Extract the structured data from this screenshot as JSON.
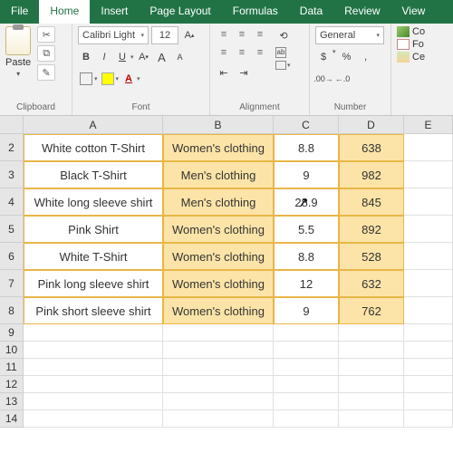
{
  "tabs": [
    "File",
    "Home",
    "Insert",
    "Page Layout",
    "Formulas",
    "Data",
    "Review",
    "View"
  ],
  "active_tab": "Home",
  "ribbon": {
    "clipboard": {
      "title": "Clipboard",
      "paste": "Paste"
    },
    "font": {
      "title": "Font",
      "name": "Calibri Light",
      "size": "12"
    },
    "alignment": {
      "title": "Alignment"
    },
    "number": {
      "title": "Number",
      "format": "General"
    },
    "styles": {
      "cond": "Co",
      "table": "Fo",
      "cell": "Ce"
    }
  },
  "columns": [
    "A",
    "B",
    "C",
    "D",
    "E"
  ],
  "rows": [
    {
      "n": "2",
      "a": "White cotton T-Shirt",
      "b": "Women's clothing",
      "c": "8.8",
      "d": "638"
    },
    {
      "n": "3",
      "a": "Black T-Shirt",
      "b": "Men's clothing",
      "c": "9",
      "d": "982"
    },
    {
      "n": "4",
      "a": "White long sleeve shirt",
      "b": "Men's clothing",
      "c": "28.9",
      "d": "845",
      "cursor": true
    },
    {
      "n": "5",
      "a": "Pink Shirt",
      "b": "Women's clothing",
      "c": "5.5",
      "d": "892"
    },
    {
      "n": "6",
      "a": "White T-Shirt",
      "b": "Women's clothing",
      "c": "8.8",
      "d": "528"
    },
    {
      "n": "7",
      "a": "Pink long sleeve shirt",
      "b": "Women's clothing",
      "c": "12",
      "d": "632"
    },
    {
      "n": "8",
      "a": "Pink short sleeve shirt",
      "b": "Women's clothing",
      "c": "9",
      "d": "762"
    }
  ],
  "empty_rows": [
    "9",
    "10",
    "11",
    "12",
    "13",
    "14"
  ]
}
